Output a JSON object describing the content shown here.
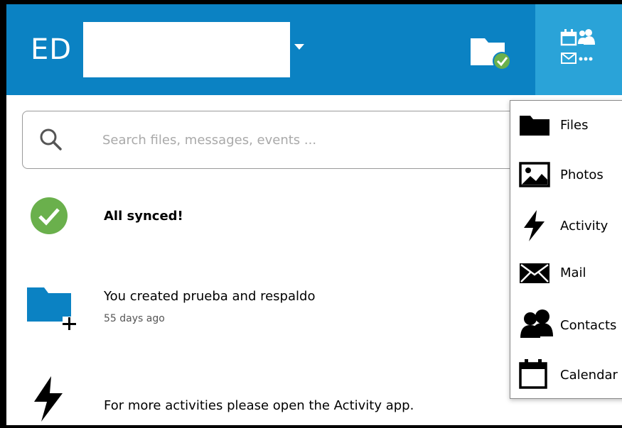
{
  "header": {
    "account_initials": "ED",
    "background_color": "#0b82c3",
    "apps_tile_color": "#2aa3d8"
  },
  "search": {
    "placeholder": "Search files, messages, events ..."
  },
  "status": {
    "synced_text": "All synced!"
  },
  "activity": {
    "title": "You created prueba and respaldo",
    "time": "55 days ago"
  },
  "footer": {
    "more_text": "For more activities please open the Activity app."
  },
  "apps_menu": {
    "items": [
      {
        "label": "Files",
        "icon": "folder-icon"
      },
      {
        "label": "Photos",
        "icon": "image-icon"
      },
      {
        "label": "Activity",
        "icon": "lightning-icon"
      },
      {
        "label": "Mail",
        "icon": "mail-icon"
      },
      {
        "label": "Contacts",
        "icon": "contacts-icon"
      },
      {
        "label": "Calendar",
        "icon": "calendar-icon"
      }
    ]
  }
}
